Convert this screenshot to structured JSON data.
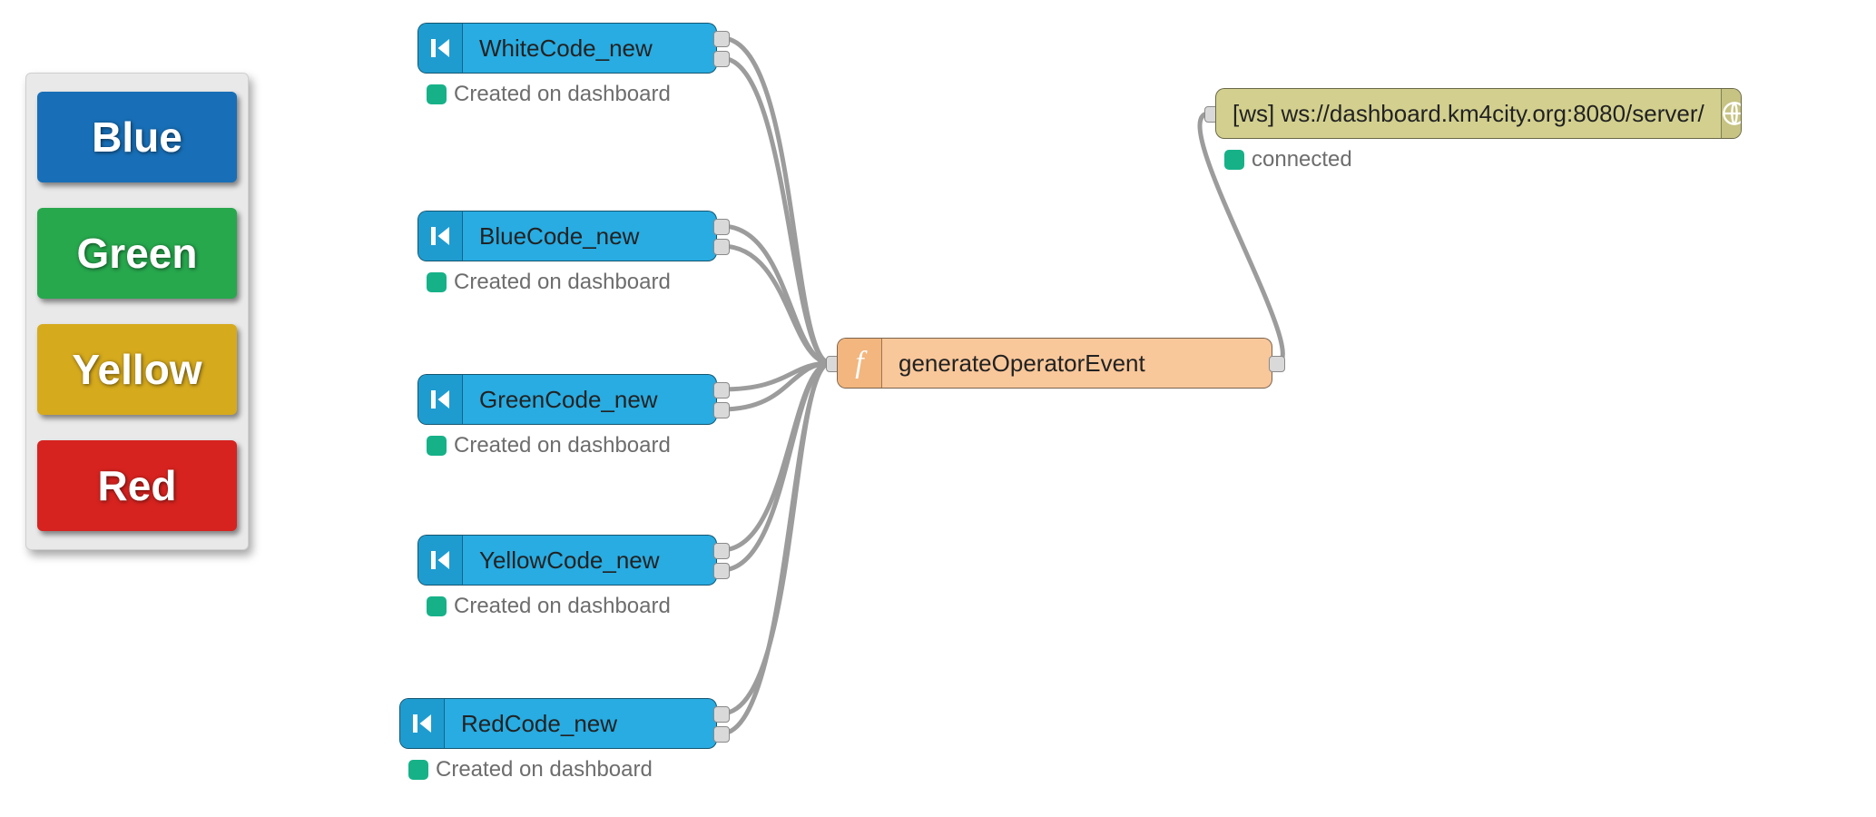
{
  "panel": {
    "buttons": [
      {
        "label": "Blue",
        "color": "#186fb7"
      },
      {
        "label": "Green",
        "color": "#27a84d"
      },
      {
        "label": "Yellow",
        "color": "#d6aa1d"
      },
      {
        "label": "Red",
        "color": "#d6231f"
      }
    ]
  },
  "nodes": {
    "injects": [
      {
        "label": "WhiteCode_new",
        "status": "Created on dashboard"
      },
      {
        "label": "BlueCode_new",
        "status": "Created on dashboard"
      },
      {
        "label": "GreenCode_new",
        "status": "Created on dashboard"
      },
      {
        "label": "YellowCode_new",
        "status": "Created on dashboard"
      },
      {
        "label": "RedCode_new",
        "status": "Created on dashboard"
      }
    ],
    "function": {
      "label": "generateOperatorEvent"
    },
    "websocket": {
      "label": "[ws] ws://dashboard.km4city.org:8080/server/",
      "status": "connected"
    }
  },
  "status_color": "#17b188"
}
